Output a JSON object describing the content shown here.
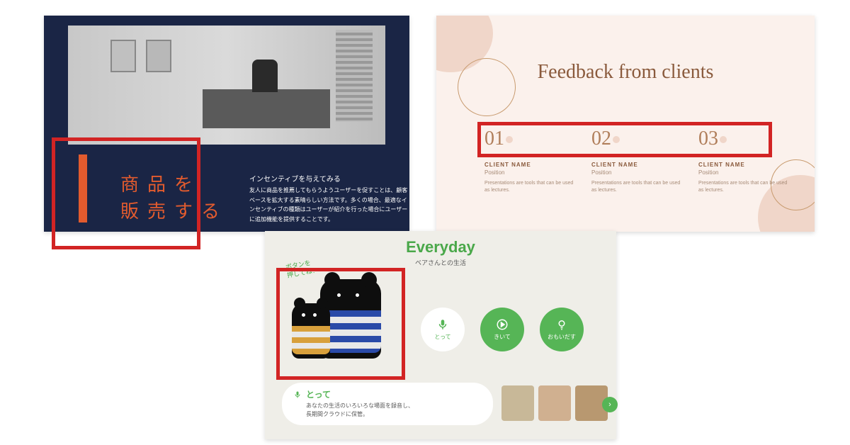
{
  "slide1": {
    "title": "商品を\n販売する",
    "subtitle": "インセンティブを与えてみる",
    "body": "友人に商品を推薦してもらうようユーザーを促すことは、顧客ベースを拡大する素晴らしい方法です。多くの場合、最適なインセンティブの種類はユーザーが紹介を行った場合にユーザーに追加機能を提供することです。"
  },
  "slide2": {
    "title": "Feedback from clients",
    "cols": [
      {
        "num": "01",
        "name": "CLIENT NAME",
        "pos": "Position",
        "desc": "Presentations are tools that can be used as lectures."
      },
      {
        "num": "02",
        "name": "CLIENT NAME",
        "pos": "Position",
        "desc": "Presentations are tools that can be used as lectures."
      },
      {
        "num": "03",
        "name": "CLIENT NAME",
        "pos": "Position",
        "desc": "Presentations are tools that can be used as lectures."
      }
    ]
  },
  "slide3": {
    "title": "Everyday",
    "subtitle": "ベアさんとの生活",
    "balloon": "ボタンを\n押してね！",
    "buttons": [
      {
        "label": "とって",
        "icon": "mic"
      },
      {
        "label": "きいて",
        "icon": "play"
      },
      {
        "label": "おもいだす",
        "icon": "bulb"
      }
    ],
    "card": {
      "title": "とって",
      "body": "あなたの生活のいろいろな場面を録音し、\n長期間クラウドに保管。"
    }
  }
}
